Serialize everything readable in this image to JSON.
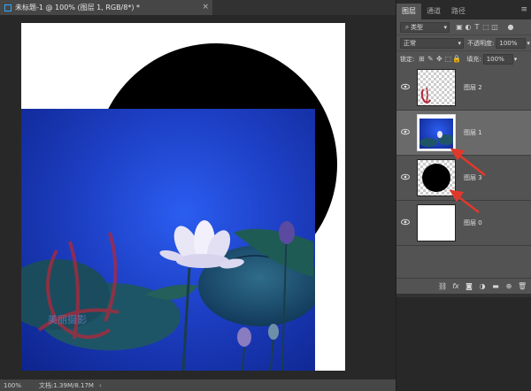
{
  "document_tab": {
    "title": "未标题-1 @ 100% (图层 1, RGB/8*) *",
    "close_glyph": "×"
  },
  "status_bar": {
    "zoom": "100%",
    "doc_info": "文档:1.39M/8.17M",
    "arrow": "›"
  },
  "panel": {
    "tabs": [
      {
        "label": "图层",
        "active": true
      },
      {
        "label": "通道",
        "active": false
      },
      {
        "label": "路径",
        "active": false
      }
    ],
    "menu_glyph": "≡",
    "filter": {
      "kind": "类型"
    },
    "blend": {
      "mode": "正常",
      "opacity_label": "不透明度:",
      "opacity_value": "100%"
    },
    "lock": {
      "label": "锁定:",
      "fill_label": "填充:",
      "fill_value": "100%"
    },
    "layers": [
      {
        "name": "图层 2",
        "thumb": "watermark",
        "selected": false
      },
      {
        "name": "图层 1",
        "thumb": "photo",
        "selected": true
      },
      {
        "name": "图层 3",
        "thumb": "circle",
        "selected": false
      },
      {
        "name": "图层 0",
        "thumb": "white",
        "selected": false
      }
    ]
  },
  "canvas": {
    "watermark_text": "美丽摄影"
  },
  "colors": {
    "canvas_bg": "#282828",
    "circle": "#000000",
    "photo_blue": "#1d3fc4",
    "arrow": "#e0392b",
    "selected_layer": "#6a6a6a"
  }
}
